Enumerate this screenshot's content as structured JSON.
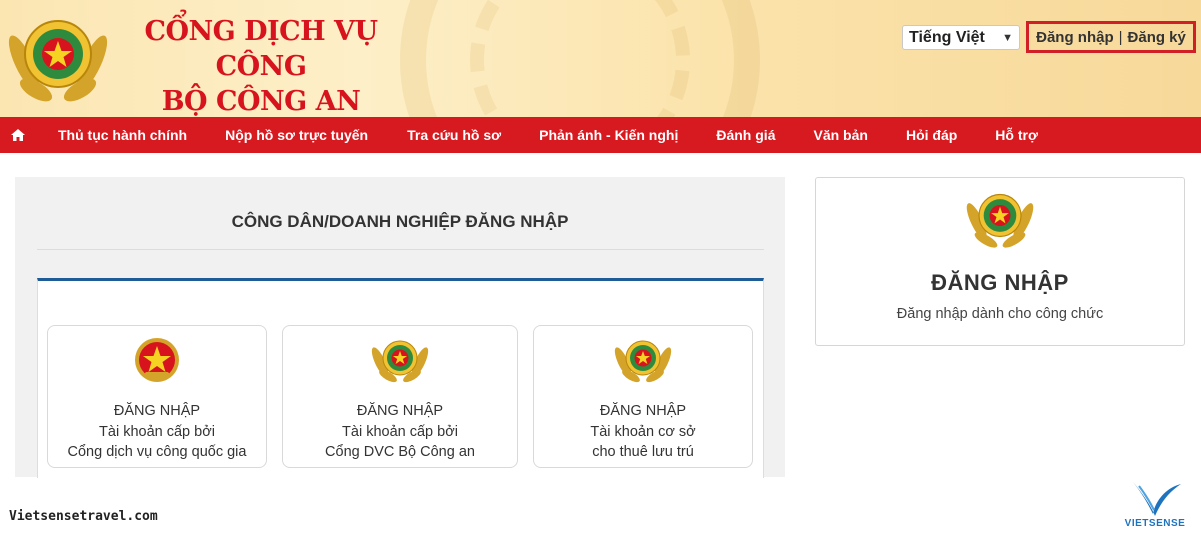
{
  "header": {
    "title_line1": "CỔNG DỊCH VỤ CÔNG",
    "title_line2": "BỘ CÔNG AN",
    "language_selected": "Tiếng Việt",
    "login_label": "Đăng nhập",
    "auth_separator": "|",
    "register_label": "Đăng ký"
  },
  "nav": {
    "home_icon": "home-icon",
    "items": [
      "Thủ tục hành chính",
      "Nộp hồ sơ trực tuyến",
      "Tra cứu hồ sơ",
      "Phản ánh - Kiến nghị",
      "Đánh giá",
      "Văn bản",
      "Hỏi đáp",
      "Hỗ trợ"
    ]
  },
  "login_panel": {
    "title": "CÔNG DÂN/DOANH NGHIỆP ĐĂNG NHẬP",
    "cards": [
      {
        "line1": "ĐĂNG NHẬP",
        "line2": "Tài khoản cấp bởi",
        "line3": "Cổng dịch vụ công quốc gia",
        "icon": "national-emblem-icon"
      },
      {
        "line1": "ĐĂNG NHẬP",
        "line2": "Tài khoản cấp bởi",
        "line3": "Cổng DVC Bộ Công an",
        "icon": "police-emblem-icon"
      },
      {
        "line1": "ĐĂNG NHẬP",
        "line2": "Tài khoản cơ sở",
        "line3": "cho thuê lưu trú",
        "icon": "police-emblem-icon"
      }
    ]
  },
  "official_panel": {
    "title": "ĐĂNG NHẬP",
    "subtitle": "Đăng nhập dành cho công chức",
    "icon": "police-emblem-icon"
  },
  "watermark": {
    "url": "Vietsensetravel.com",
    "brand": "VIETSENSE"
  },
  "colors": {
    "brand_red": "#d71920",
    "header_bg": "#fbe6b2",
    "accent_blue": "#1d5c96"
  }
}
